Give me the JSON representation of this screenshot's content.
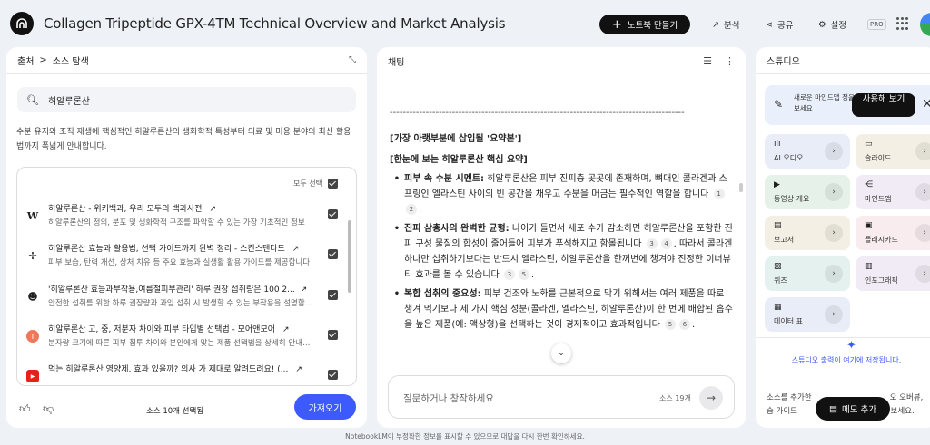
{
  "header": {
    "title": "Collagen Tripeptide GPX-4TM Technical Overview and Market Analysis",
    "create_notebook": "노트북 만들기",
    "analytics": "분석",
    "share": "공유",
    "settings": "설정",
    "pro_badge": "PRO"
  },
  "sources": {
    "breadcrumb_a": "출처",
    "breadcrumb_b": "소스 탐색",
    "selected_source": "히알루론산",
    "description": "수분 유지와 조직 재생에 핵심적인 히알루론산의 생화학적 특성부터 의료 및 미용 분야의 최신 활용법까지 폭넓게 안내합니다.",
    "select_all": "모두 선택",
    "items": [
      {
        "title": "히알루론산 - 위키백과, 우리 모두의 백과사전",
        "snippet": "히알루론산의 정의, 분포 및 생화학적 구조를 파악할 수 있는 가장 기초적인 정보",
        "icon": "W"
      },
      {
        "title": "히알루론산 효능과 활용법, 선택 가이드까지 완벽 정리 - 스킨스탠다드",
        "snippet": "피부 보습, 탄력 개선, 상처 치유 등 주요 효능과 실생활 활용 가이드를 제공합니다",
        "icon": "✢"
      },
      {
        "title": "'히알루론산 효능과부작용,여름철피부관리' 하루 권장 섭취량은 100 2...",
        "snippet": "안전한 섭취를 위한 하루 권장량과 과잉 섭취 시 발생할 수 있는 부작용을 설명합니다",
        "icon": "☻"
      },
      {
        "title": "히알루론산 고, 중, 저분자 차이와 피부 타입별 선택법 - 모어앤모어",
        "snippet": "분자량 크기에 따른 피부 침투 차이와 본인에게 맞는 제품 선택법을 상세히 안내합니다",
        "icon": "T"
      },
      {
        "title": "먹는 히알루론산 영양제, 효과 있을까? 의사 가 제대로 알려드려요! (...",
        "snippet": "",
        "icon": "▶"
      }
    ],
    "selected_count": "소스 10개 선택됨",
    "import_button": "가져오기"
  },
  "chat": {
    "title": "채팅",
    "dashes": "------------------------------------------------------------------------------------------",
    "heading1": "[가장 아랫부분에 삽입될 '요약본']",
    "heading2": "[한눈에 보는 히알루론산 핵심 요약]",
    "bullets": [
      {
        "bold": "피부 속 수분 시멘트:",
        "text": " 히알루론산은 피부 진피층 곳곳에 존재하며, 뼈대인 콜라겐과 스프링인 엘라스틴 사이의 빈 공간을 채우고 수분을 머금는 필수적인 역할을 합니다",
        "cites": [
          "1",
          "2"
        ]
      },
      {
        "bold": "진피 삼총사의 완벽한 균형:",
        "text": " 나이가 들면서 세포 수가 감소하면 히알루론산을 포함한 진피 구성 물질의 합성이 줄어들어 피부가 푸석해지고 함몰됩니다",
        "cite_a": [
          "3",
          "4"
        ],
        "text2": ". 따라서 콜라겐 하나만 섭취하기보다는 반드시 엘라스틴, 히알루론산을 한꺼번에 챙겨야 진정한 이너뷰티 효과를 볼 수 있습니다",
        "cite_b": [
          "3",
          "5"
        ]
      },
      {
        "bold": "복합 섭취의 중요성:",
        "text": " 피부 건조와 노화를 근본적으로 막기 위해서는 여러 제품을 따로 챙겨 먹기보다 세 가지 핵심 성분(콜라겐, 엘라스틴, 히알루론산)이 한 번에 배합된 흡수율 높은 제",
        "text_b": "품(예: 액상형)을 선택하는 것이 경제적이고 효과적입니다",
        "cites": [
          "5",
          "6"
        ]
      }
    ],
    "input_placeholder": "질문하거나 창작하세요",
    "source_count": "소스 19개"
  },
  "studio": {
    "title": "스튜디오",
    "banner_text": "새로운 마인드맵 정을 사용해 보세요",
    "banner_button": "사용해 보기",
    "tiles": [
      {
        "label": "AI 오디오 ...",
        "icon": "ılı",
        "color": "#e9edf7"
      },
      {
        "label": "슬라이드 ...",
        "icon": "▭",
        "color": "#f3efe4"
      },
      {
        "label": "동영상 개요",
        "icon": "▶",
        "color": "#e5f1e9"
      },
      {
        "label": "마인드맵",
        "icon": "⋲",
        "color": "#f1ebf5"
      },
      {
        "label": "보고서",
        "icon": "▤",
        "color": "#f3efe4"
      },
      {
        "label": "플래시카드",
        "icon": "▣",
        "color": "#f8ecef"
      },
      {
        "label": "퀴즈",
        "icon": "▨",
        "color": "#e4f1ef"
      },
      {
        "label": "인포그래픽",
        "icon": "▥",
        "color": "#f1ebf5"
      },
      {
        "label": "데이터 표",
        "icon": "▦",
        "color": "#e9edf7"
      }
    ],
    "saved_text": "스튜디오 출력이 여기에 저장됩니다.",
    "desc_a": "소스를 추가한",
    "desc_b": "오 오버뷰,",
    "desc_c": "습 가이드",
    "desc_d": "해 보세요.",
    "memo_button": "메모 추가"
  },
  "disclaimer": "NotebookLM이 부정확한 정보를 표시할 수 있으므로 대답을 다시 한번 확인하세요."
}
